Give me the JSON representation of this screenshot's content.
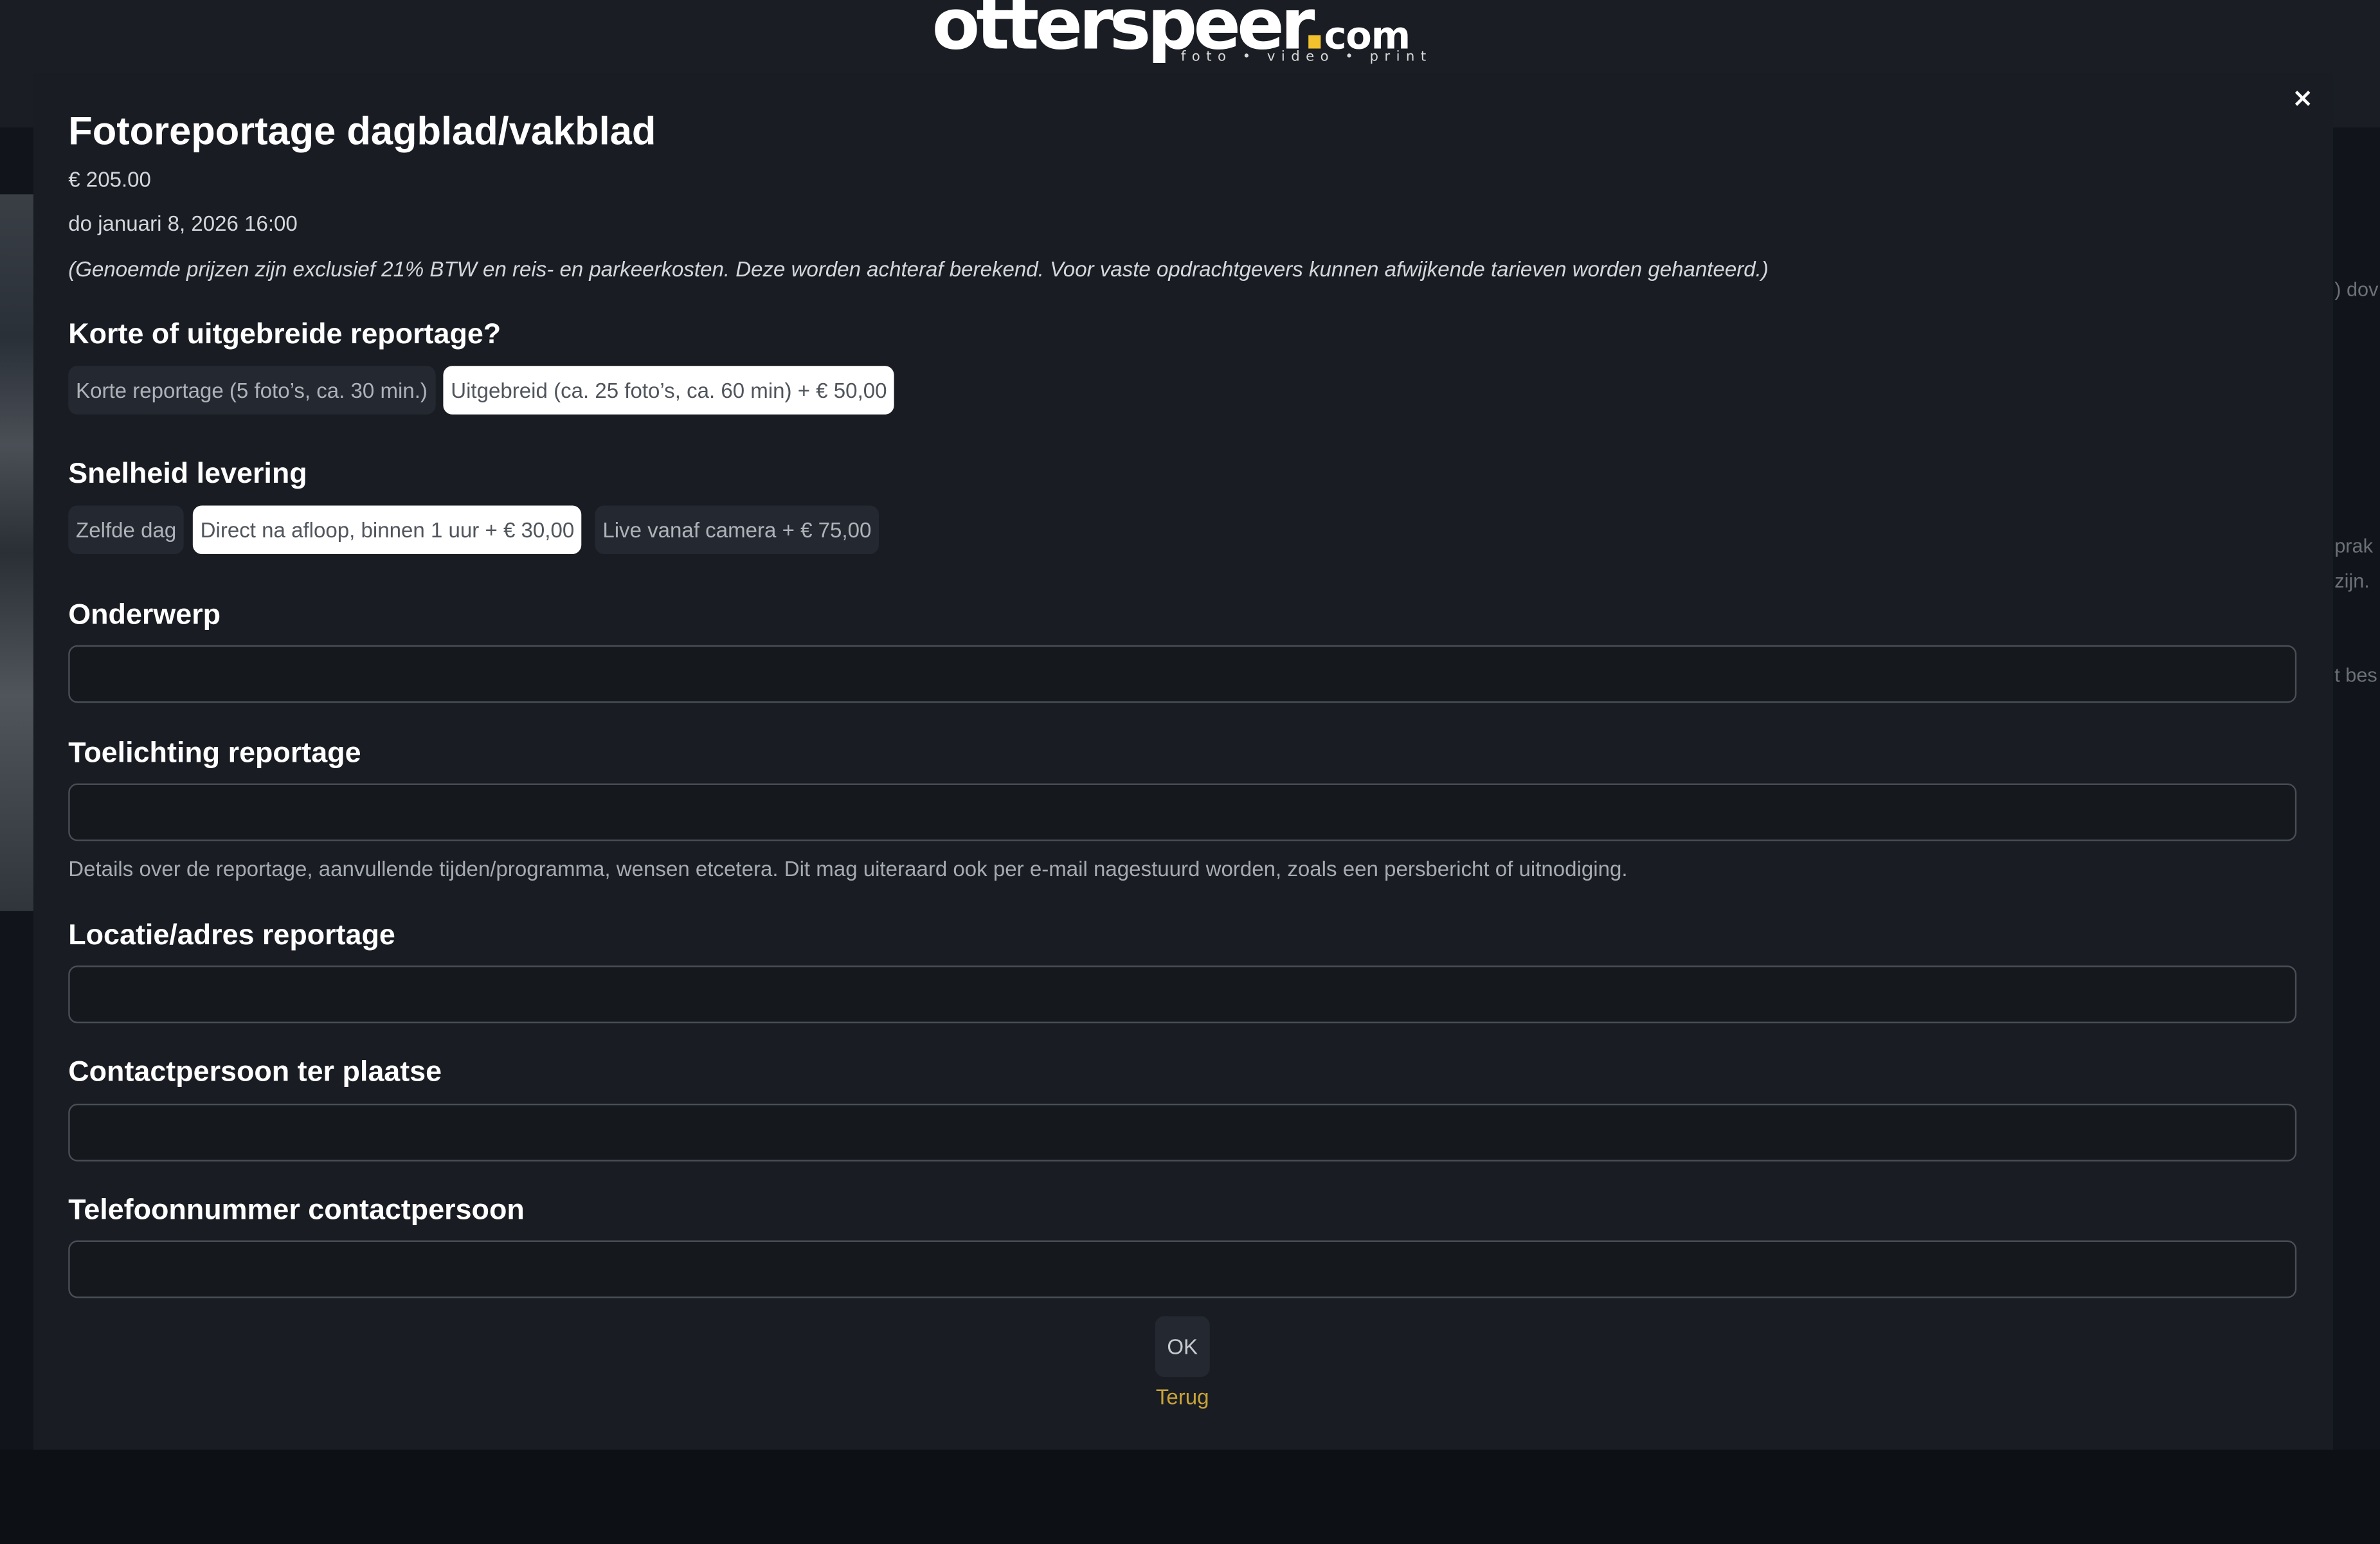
{
  "brand": {
    "logo_main": "otterspeer",
    "logo_dot": ".",
    "logo_tld": "com",
    "tagline": "foto • video • print",
    "accent_color": "#f2c12e"
  },
  "background": {
    "right_snippets": [
      ") dov",
      "prak",
      "zijn.",
      "t bes"
    ]
  },
  "modal": {
    "close_icon": "×",
    "title": "Fotoreportage dagblad/vakblad",
    "price": "€ 205.00",
    "datetime": "do januari 8, 2026 16:00",
    "disclaimer": "(Genoemde prijzen zijn exclusief 21% BTW en reis- en parkeerkosten. Deze worden achteraf berekend. Voor vaste opdrachtgevers kunnen afwijkende tarieven worden gehanteerd.)",
    "sections": {
      "length": {
        "label": "Korte of uitgebreide reportage?",
        "options": [
          {
            "label": "Korte reportage (5 foto’s, ca. 30 min.)",
            "selected": false
          },
          {
            "label": "Uitgebreid (ca. 25 foto’s, ca. 60 min) + € 50,00",
            "selected": true
          }
        ]
      },
      "delivery": {
        "label": "Snelheid levering",
        "options": [
          {
            "label": "Zelfde dag",
            "selected": false
          },
          {
            "label": "Direct na afloop, binnen 1 uur + € 30,00",
            "selected": true
          },
          {
            "label": "Live vanaf camera + € 75,00",
            "selected": false
          }
        ]
      }
    },
    "fields": {
      "subject": {
        "label": "Onderwerp",
        "value": ""
      },
      "explanation": {
        "label": "Toelichting reportage",
        "value": "",
        "help": "Details over de reportage, aanvullende tijden/programma, wensen etcetera. Dit mag uiteraard ook per e-mail nagestuurd worden, zoals een persbericht of uitnodiging."
      },
      "location": {
        "label": "Locatie/adres reportage",
        "value": ""
      },
      "contact": {
        "label": "Contactpersoon ter plaatse",
        "value": ""
      },
      "phone": {
        "label": "Telefoonnummer contactpersoon",
        "value": ""
      }
    },
    "ok_label": "OK",
    "back_label": "Terug"
  }
}
